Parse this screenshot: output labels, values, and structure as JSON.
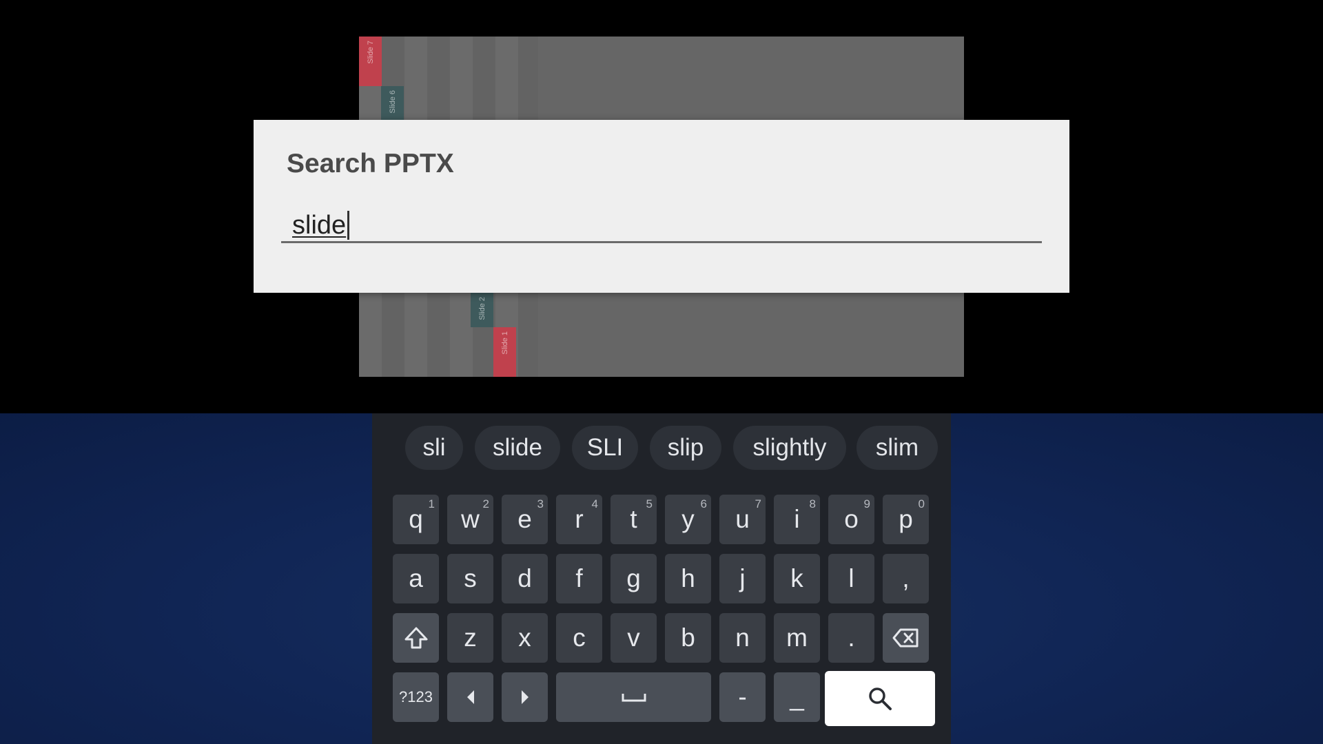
{
  "dialog": {
    "title": "Search PPTX",
    "search_value": "slide"
  },
  "preview": {
    "slide_tabs": [
      "Slide 7",
      "Slide 6",
      "Slide 2",
      "Slide 1"
    ]
  },
  "suggestions": [
    "sli",
    "slide",
    "SLI",
    "slip",
    "slightly",
    "slim"
  ],
  "keyboard": {
    "row1": [
      {
        "key": "q",
        "hint": "1"
      },
      {
        "key": "w",
        "hint": "2"
      },
      {
        "key": "e",
        "hint": "3"
      },
      {
        "key": "r",
        "hint": "4"
      },
      {
        "key": "t",
        "hint": "5"
      },
      {
        "key": "y",
        "hint": "6"
      },
      {
        "key": "u",
        "hint": "7"
      },
      {
        "key": "i",
        "hint": "8"
      },
      {
        "key": "o",
        "hint": "9"
      },
      {
        "key": "p",
        "hint": "0"
      }
    ],
    "row2": [
      "a",
      "s",
      "d",
      "f",
      "g",
      "h",
      "j",
      "k",
      "l",
      ","
    ],
    "row3": [
      "z",
      "x",
      "c",
      "v",
      "b",
      "n",
      "m",
      "."
    ],
    "row4": {
      "symbols": "?123",
      "dash": "-",
      "underscore": "_"
    }
  },
  "colors": {
    "slide_red": "#c0414d",
    "slide_teal": "#3e5a5c",
    "search_key": "#ffffff"
  }
}
